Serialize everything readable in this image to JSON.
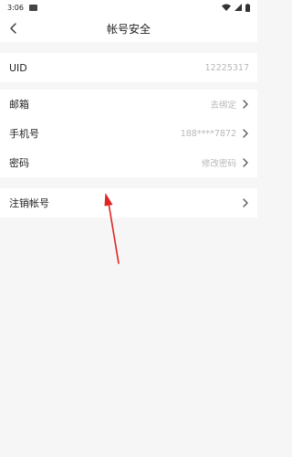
{
  "status_bar": {
    "time": "3:06"
  },
  "header": {
    "title": "帐号安全"
  },
  "rows": {
    "uid": {
      "label": "UID",
      "value": "12225317"
    },
    "email": {
      "label": "邮箱",
      "value": "去绑定"
    },
    "phone": {
      "label": "手机号",
      "value": "188****7872"
    },
    "password": {
      "label": "密码",
      "value": "修改密码"
    },
    "cancel_account": {
      "label": "注销帐号"
    }
  },
  "colors": {
    "annotation_arrow": "#e02424",
    "secondary_text": "#b8b8b8",
    "background": "#f6f6f6"
  }
}
